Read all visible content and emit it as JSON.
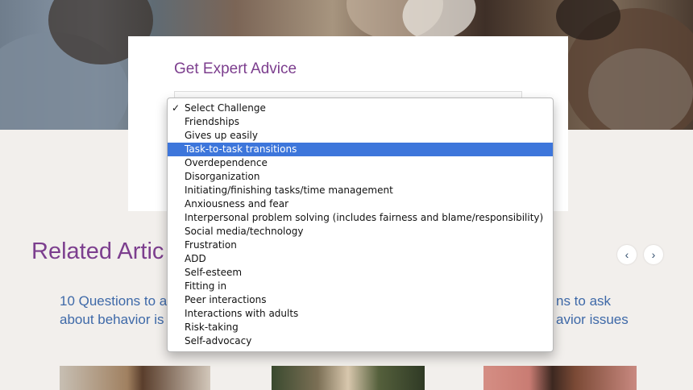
{
  "expert_card": {
    "title": "Get Expert Advice"
  },
  "dropdown": {
    "options": [
      {
        "label": "Select Challenge",
        "checked": true,
        "highlighted": false
      },
      {
        "label": "Friendships",
        "checked": false,
        "highlighted": false
      },
      {
        "label": "Gives up easily",
        "checked": false,
        "highlighted": false
      },
      {
        "label": "Task-to-task transitions",
        "checked": false,
        "highlighted": true
      },
      {
        "label": "Overdependence",
        "checked": false,
        "highlighted": false
      },
      {
        "label": "Disorganization",
        "checked": false,
        "highlighted": false
      },
      {
        "label": "Initiating/finishing tasks/time management",
        "checked": false,
        "highlighted": false
      },
      {
        "label": "Anxiousness and fear",
        "checked": false,
        "highlighted": false
      },
      {
        "label": "Interpersonal problem solving (includes fairness and blame/responsibility)",
        "checked": false,
        "highlighted": false
      },
      {
        "label": "Social media/technology",
        "checked": false,
        "highlighted": false
      },
      {
        "label": "Frustration",
        "checked": false,
        "highlighted": false
      },
      {
        "label": "ADD",
        "checked": false,
        "highlighted": false
      },
      {
        "label": "Self-esteem",
        "checked": false,
        "highlighted": false
      },
      {
        "label": "Fitting in",
        "checked": false,
        "highlighted": false
      },
      {
        "label": "Peer interactions",
        "checked": false,
        "highlighted": false
      },
      {
        "label": "Interactions with adults",
        "checked": false,
        "highlighted": false
      },
      {
        "label": "Risk-taking",
        "checked": false,
        "highlighted": false
      },
      {
        "label": "Self-advocacy",
        "checked": false,
        "highlighted": false
      }
    ],
    "check_glyph": "✓"
  },
  "related": {
    "title": "Related Artic",
    "prev_icon": "‹",
    "next_icon": "›",
    "articles": [
      {
        "line1": "10 Questions to a",
        "line2": "about behavior is"
      },
      {
        "line1": "ns to ask",
        "line2": "avior issues"
      }
    ]
  },
  "colors": {
    "accent_purple": "#7c3e8e",
    "link_blue": "#3e69a8",
    "highlight_blue": "#3d76db"
  }
}
